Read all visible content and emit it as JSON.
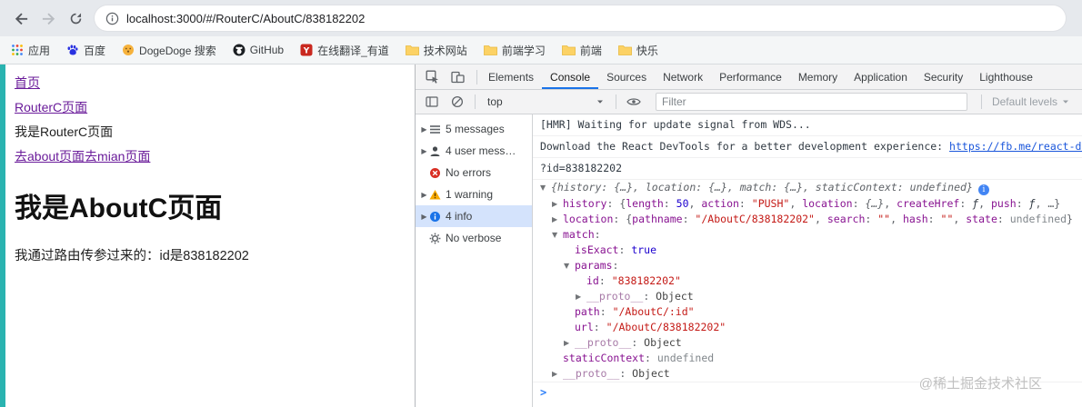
{
  "browser": {
    "url": "localhost:3000/#/RouterC/AboutC/838182202",
    "bookmarks": [
      {
        "label": "应用",
        "icon": "apps"
      },
      {
        "label": "百度",
        "icon": "paw"
      },
      {
        "label": "DogeDoge 搜索",
        "icon": "doge"
      },
      {
        "label": "GitHub",
        "icon": "github"
      },
      {
        "label": "在线翻译_有道",
        "icon": "youdao"
      },
      {
        "label": "技术网站",
        "icon": "folder"
      },
      {
        "label": "前端学习",
        "icon": "folder"
      },
      {
        "label": "前端",
        "icon": "folder"
      },
      {
        "label": "快乐",
        "icon": "folder"
      }
    ]
  },
  "page": {
    "nav_links": [
      "首页",
      "RouterC页面"
    ],
    "static_text": "我是RouterC页面",
    "inline_links": [
      "去about页面",
      "去mian页面"
    ],
    "heading": "我是AboutC页面",
    "paragraph": "我通过路由传参过来的：id是838182202"
  },
  "devtools": {
    "tabs": [
      "Elements",
      "Console",
      "Sources",
      "Network",
      "Performance",
      "Memory",
      "Application",
      "Security",
      "Lighthouse"
    ],
    "active_tab": "Console",
    "toolbar": {
      "context": "top",
      "filter_placeholder": "Filter",
      "levels_label": "Default levels"
    },
    "sidebar": [
      {
        "key": "messages",
        "icon": "list",
        "arrow": true,
        "label": "5 messages"
      },
      {
        "key": "user-messages",
        "icon": "user",
        "arrow": true,
        "label": "4 user mess…"
      },
      {
        "key": "errors",
        "icon": "error",
        "arrow": false,
        "label": "No errors"
      },
      {
        "key": "warnings",
        "icon": "warning",
        "arrow": true,
        "label": "1 warning"
      },
      {
        "key": "info",
        "icon": "info",
        "arrow": true,
        "label": "4 info",
        "selected": true
      },
      {
        "key": "verbose",
        "icon": "verbose",
        "arrow": false,
        "label": "No verbose"
      }
    ],
    "console": {
      "prompt": ">",
      "lines": [
        {
          "m": true,
          "b": true,
          "ind": 0,
          "seg": [
            {
              "t": "[HMR] Waiting for update signal from WDS...",
              "c": "plain"
            }
          ]
        },
        {
          "m": true,
          "b": true,
          "ind": 0,
          "seg": [
            {
              "t": "Download the React DevTools for a better development experience: ",
              "c": "plain"
            },
            {
              "t": "https://fb.me/react-devtools",
              "c": "link"
            }
          ]
        },
        {
          "m": true,
          "b": true,
          "ind": 0,
          "seg": [
            {
              "t": "?id=838182202",
              "c": "plain"
            }
          ]
        },
        {
          "ind": 0,
          "a": "d",
          "icon": "info",
          "seg": [
            {
              "t": "{history: {…}, location: {…}, match: {…}, staticContext: undefined}",
              "c": "prev"
            }
          ]
        },
        {
          "ind": 1,
          "a": "r",
          "seg": [
            {
              "t": "history",
              "c": "key"
            },
            {
              "t": ": {",
              "c": "punct"
            },
            {
              "t": "length",
              "c": "pkey"
            },
            {
              "t": ": ",
              "c": "punct"
            },
            {
              "t": "50",
              "c": "num"
            },
            {
              "t": ", ",
              "c": "punct"
            },
            {
              "t": "action",
              "c": "pkey"
            },
            {
              "t": ": ",
              "c": "punct"
            },
            {
              "t": "\"PUSH\"",
              "c": "str"
            },
            {
              "t": ", ",
              "c": "punct"
            },
            {
              "t": "location",
              "c": "pkey"
            },
            {
              "t": ": ",
              "c": "punct"
            },
            {
              "t": "{…}",
              "c": "prev"
            },
            {
              "t": ", ",
              "c": "punct"
            },
            {
              "t": "createHref",
              "c": "pkey"
            },
            {
              "t": ": ",
              "c": "punct"
            },
            {
              "t": "ƒ",
              "c": "fn"
            },
            {
              "t": ", ",
              "c": "punct"
            },
            {
              "t": "push",
              "c": "pkey"
            },
            {
              "t": ": ",
              "c": "punct"
            },
            {
              "t": "ƒ",
              "c": "fn"
            },
            {
              "t": ", …}",
              "c": "punct"
            }
          ]
        },
        {
          "ind": 1,
          "a": "r",
          "seg": [
            {
              "t": "location",
              "c": "key"
            },
            {
              "t": ": {",
              "c": "punct"
            },
            {
              "t": "pathname",
              "c": "pkey"
            },
            {
              "t": ": ",
              "c": "punct"
            },
            {
              "t": "\"/AboutC/838182202\"",
              "c": "str"
            },
            {
              "t": ", ",
              "c": "punct"
            },
            {
              "t": "search",
              "c": "pkey"
            },
            {
              "t": ": ",
              "c": "punct"
            },
            {
              "t": "\"\"",
              "c": "str"
            },
            {
              "t": ", ",
              "c": "punct"
            },
            {
              "t": "hash",
              "c": "pkey"
            },
            {
              "t": ": ",
              "c": "punct"
            },
            {
              "t": "\"\"",
              "c": "str"
            },
            {
              "t": ", ",
              "c": "punct"
            },
            {
              "t": "state",
              "c": "pkey"
            },
            {
              "t": ": ",
              "c": "punct"
            },
            {
              "t": "undefined",
              "c": "undef"
            },
            {
              "t": "}",
              "c": "punct"
            }
          ]
        },
        {
          "ind": 1,
          "a": "d",
          "seg": [
            {
              "t": "match",
              "c": "key"
            },
            {
              "t": ":",
              "c": "punct"
            }
          ]
        },
        {
          "ind": 2,
          "seg": [
            {
              "t": "isExact",
              "c": "key"
            },
            {
              "t": ": ",
              "c": "punct"
            },
            {
              "t": "true",
              "c": "bool"
            }
          ]
        },
        {
          "ind": 2,
          "a": "d",
          "seg": [
            {
              "t": "params",
              "c": "key"
            },
            {
              "t": ":",
              "c": "punct"
            }
          ]
        },
        {
          "ind": 3,
          "seg": [
            {
              "t": "id",
              "c": "key"
            },
            {
              "t": ": ",
              "c": "punct"
            },
            {
              "t": "\"838182202\"",
              "c": "str"
            }
          ]
        },
        {
          "ind": 3,
          "a": "r",
          "seg": [
            {
              "t": "__proto__",
              "c": "proto"
            },
            {
              "t": ": ",
              "c": "punct"
            },
            {
              "t": "Object",
              "c": "obj"
            }
          ]
        },
        {
          "ind": 2,
          "seg": [
            {
              "t": "path",
              "c": "key"
            },
            {
              "t": ": ",
              "c": "punct"
            },
            {
              "t": "\"/AboutC/:id\"",
              "c": "str"
            }
          ]
        },
        {
          "ind": 2,
          "seg": [
            {
              "t": "url",
              "c": "key"
            },
            {
              "t": ": ",
              "c": "punct"
            },
            {
              "t": "\"/AboutC/838182202\"",
              "c": "str"
            }
          ]
        },
        {
          "ind": 2,
          "a": "r",
          "seg": [
            {
              "t": "__proto__",
              "c": "proto"
            },
            {
              "t": ": ",
              "c": "punct"
            },
            {
              "t": "Object",
              "c": "obj"
            }
          ]
        },
        {
          "ind": 1,
          "seg": [
            {
              "t": "staticContext",
              "c": "key"
            },
            {
              "t": ": ",
              "c": "punct"
            },
            {
              "t": "undefined",
              "c": "undef"
            }
          ]
        },
        {
          "ind": 1,
          "a": "r",
          "b": true,
          "seg": [
            {
              "t": "__proto__",
              "c": "proto"
            },
            {
              "t": ": ",
              "c": "punct"
            },
            {
              "t": "Object",
              "c": "obj"
            }
          ]
        }
      ]
    }
  },
  "watermark": "@稀土掘金技术社区"
}
